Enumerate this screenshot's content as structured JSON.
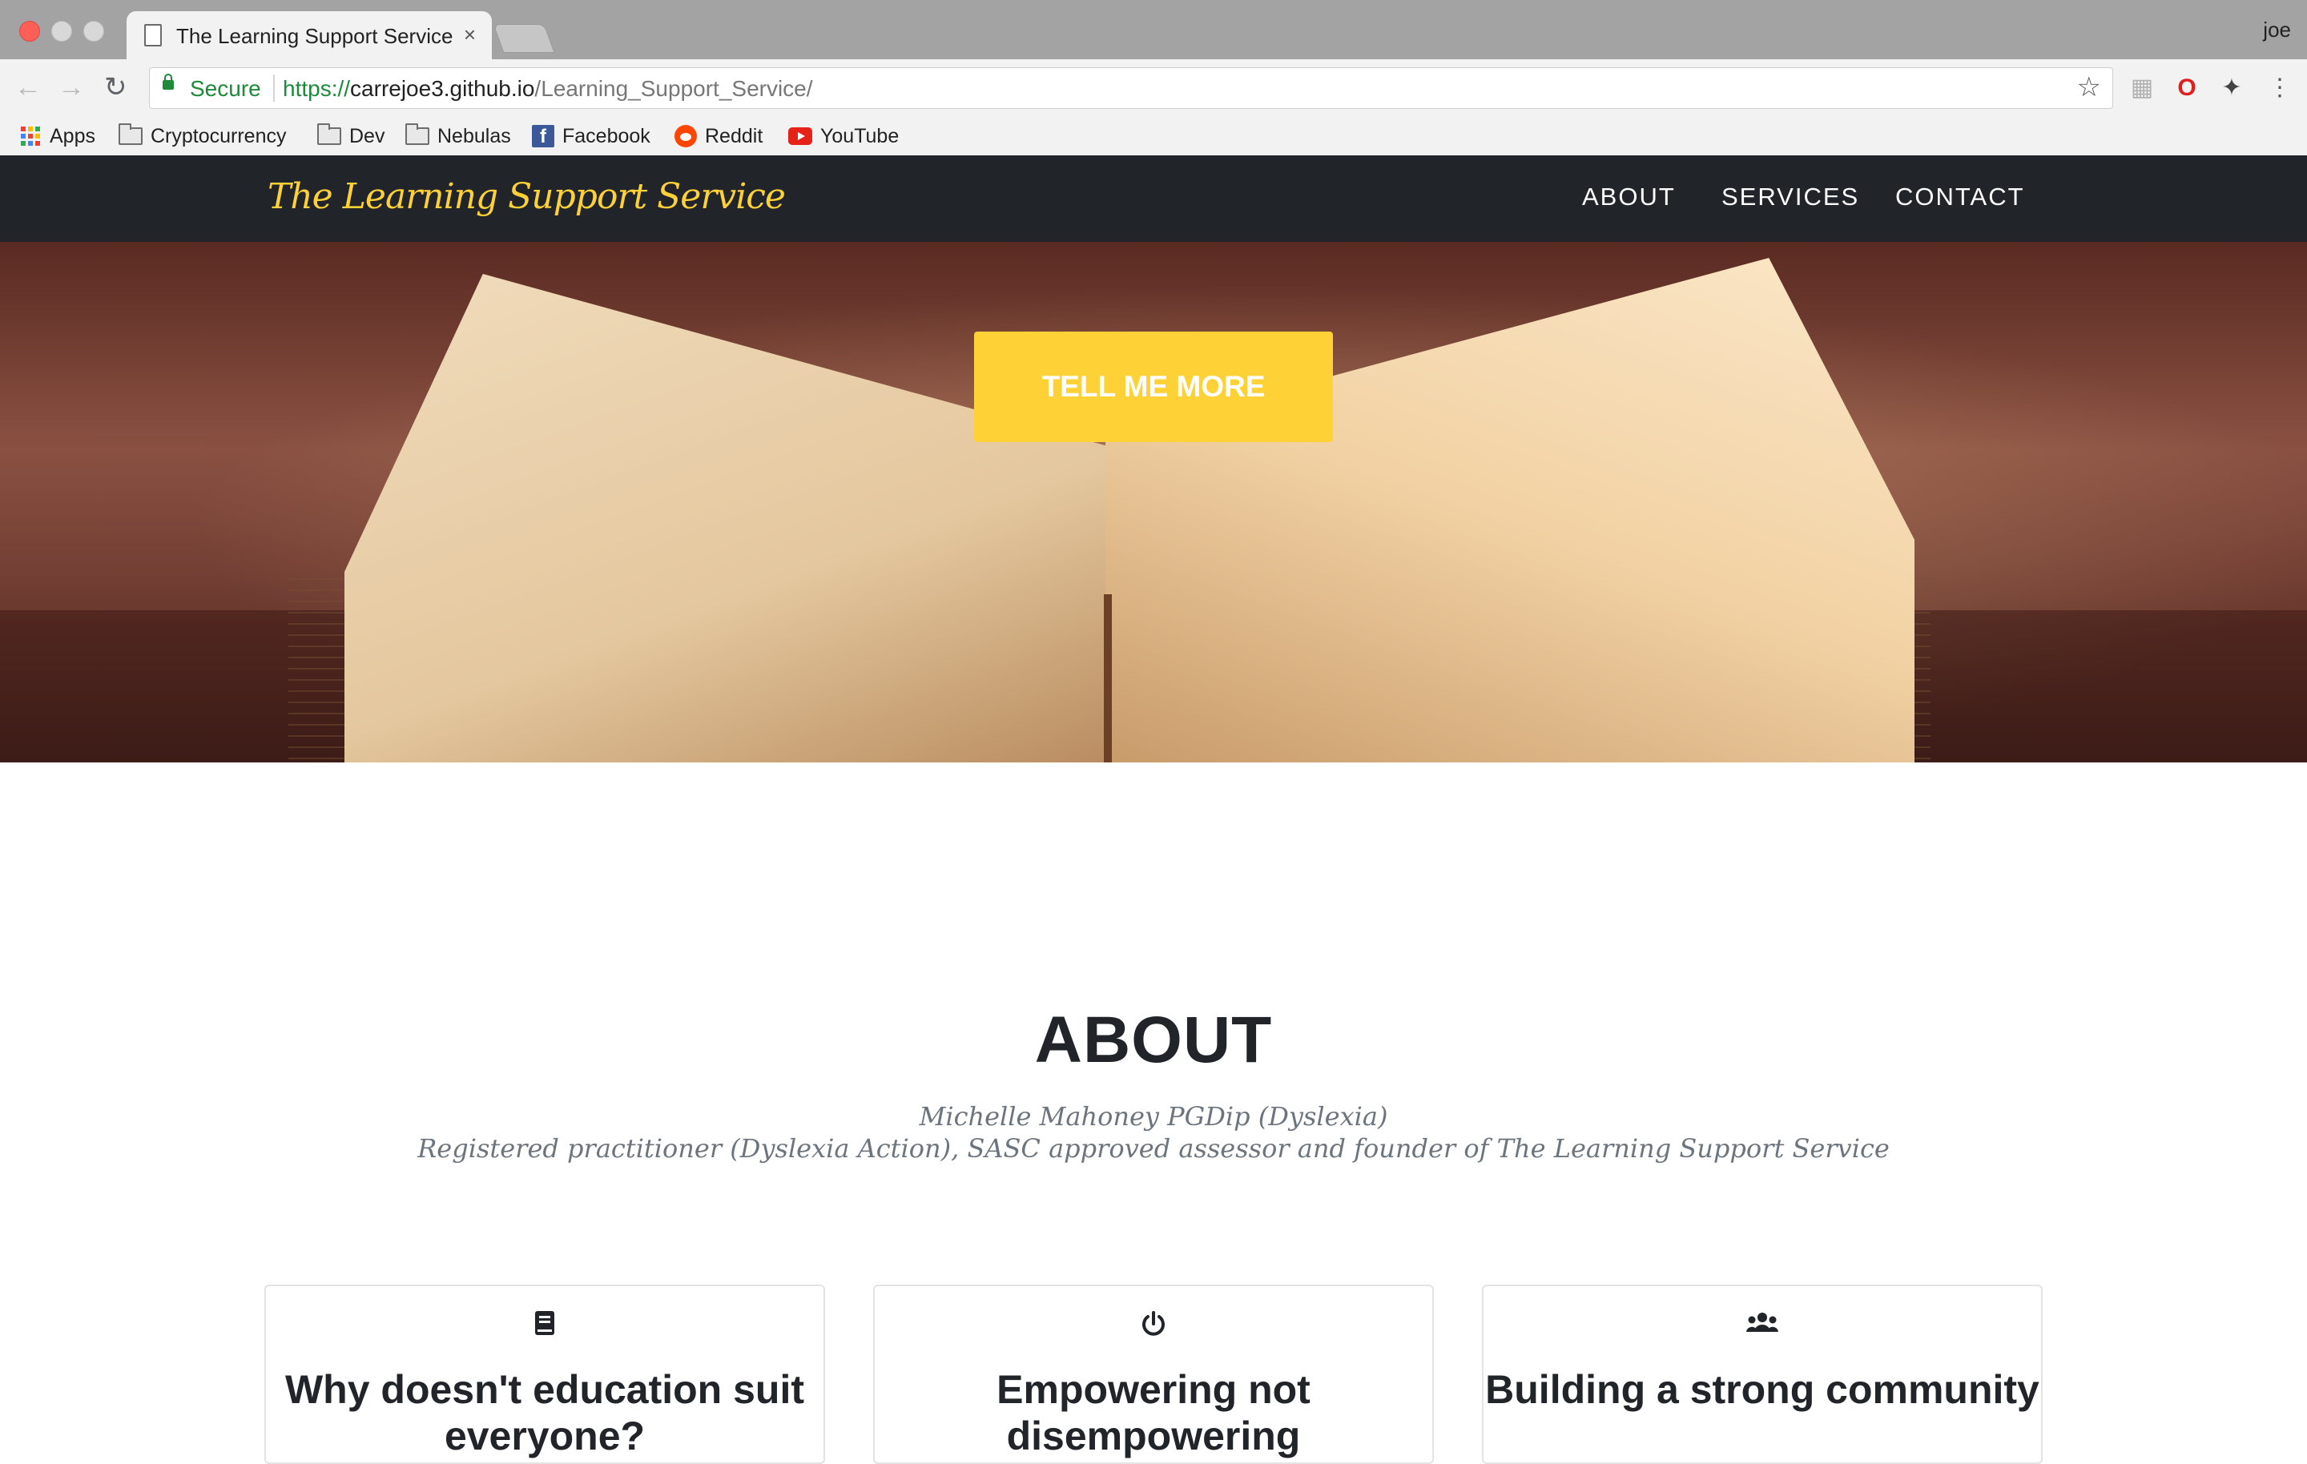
{
  "browser": {
    "tab_title": "The Learning Support Service",
    "tab_close": "×",
    "profile_name": "joe",
    "secure_label": "Secure",
    "url_scheme": "https://",
    "url_host": "carrejoe3.github.io",
    "url_path": "/Learning_Support_Service/",
    "bookmarks": [
      {
        "label": "Apps",
        "icon": "apps-grid-icon"
      },
      {
        "label": "Cryptocurrency",
        "icon": "folder-icon"
      },
      {
        "label": "Dev",
        "icon": "folder-icon"
      },
      {
        "label": "Nebulas",
        "icon": "folder-icon"
      },
      {
        "label": "Facebook",
        "icon": "facebook-icon"
      },
      {
        "label": "Reddit",
        "icon": "reddit-icon"
      },
      {
        "label": "YouTube",
        "icon": "youtube-icon"
      }
    ],
    "colors": {
      "secure_green": "#1d8a3a",
      "close_red": "#fc5f57"
    }
  },
  "site": {
    "brand": "The Learning Support Service",
    "nav": [
      {
        "label": "ABOUT"
      },
      {
        "label": "SERVICES"
      },
      {
        "label": "CONTACT"
      }
    ],
    "hero": {
      "cta_label": "TELL ME MORE"
    },
    "about": {
      "heading": "ABOUT",
      "subheading_line1": "Michelle Mahoney PGDip (Dyslexia)",
      "subheading_line2": "Registered practitioner (Dyslexia Action), SASC approved assessor and founder of The Learning Support Service",
      "cards": [
        {
          "icon": "book-icon",
          "title": "Why doesn't education suit everyone?"
        },
        {
          "icon": "power-icon",
          "title": "Empowering not disempowering"
        },
        {
          "icon": "users-icon",
          "title": "Building a strong community"
        }
      ]
    },
    "colors": {
      "accent_yellow": "#fed136",
      "nav_dark": "#212529",
      "muted_text": "#6c757d"
    }
  }
}
